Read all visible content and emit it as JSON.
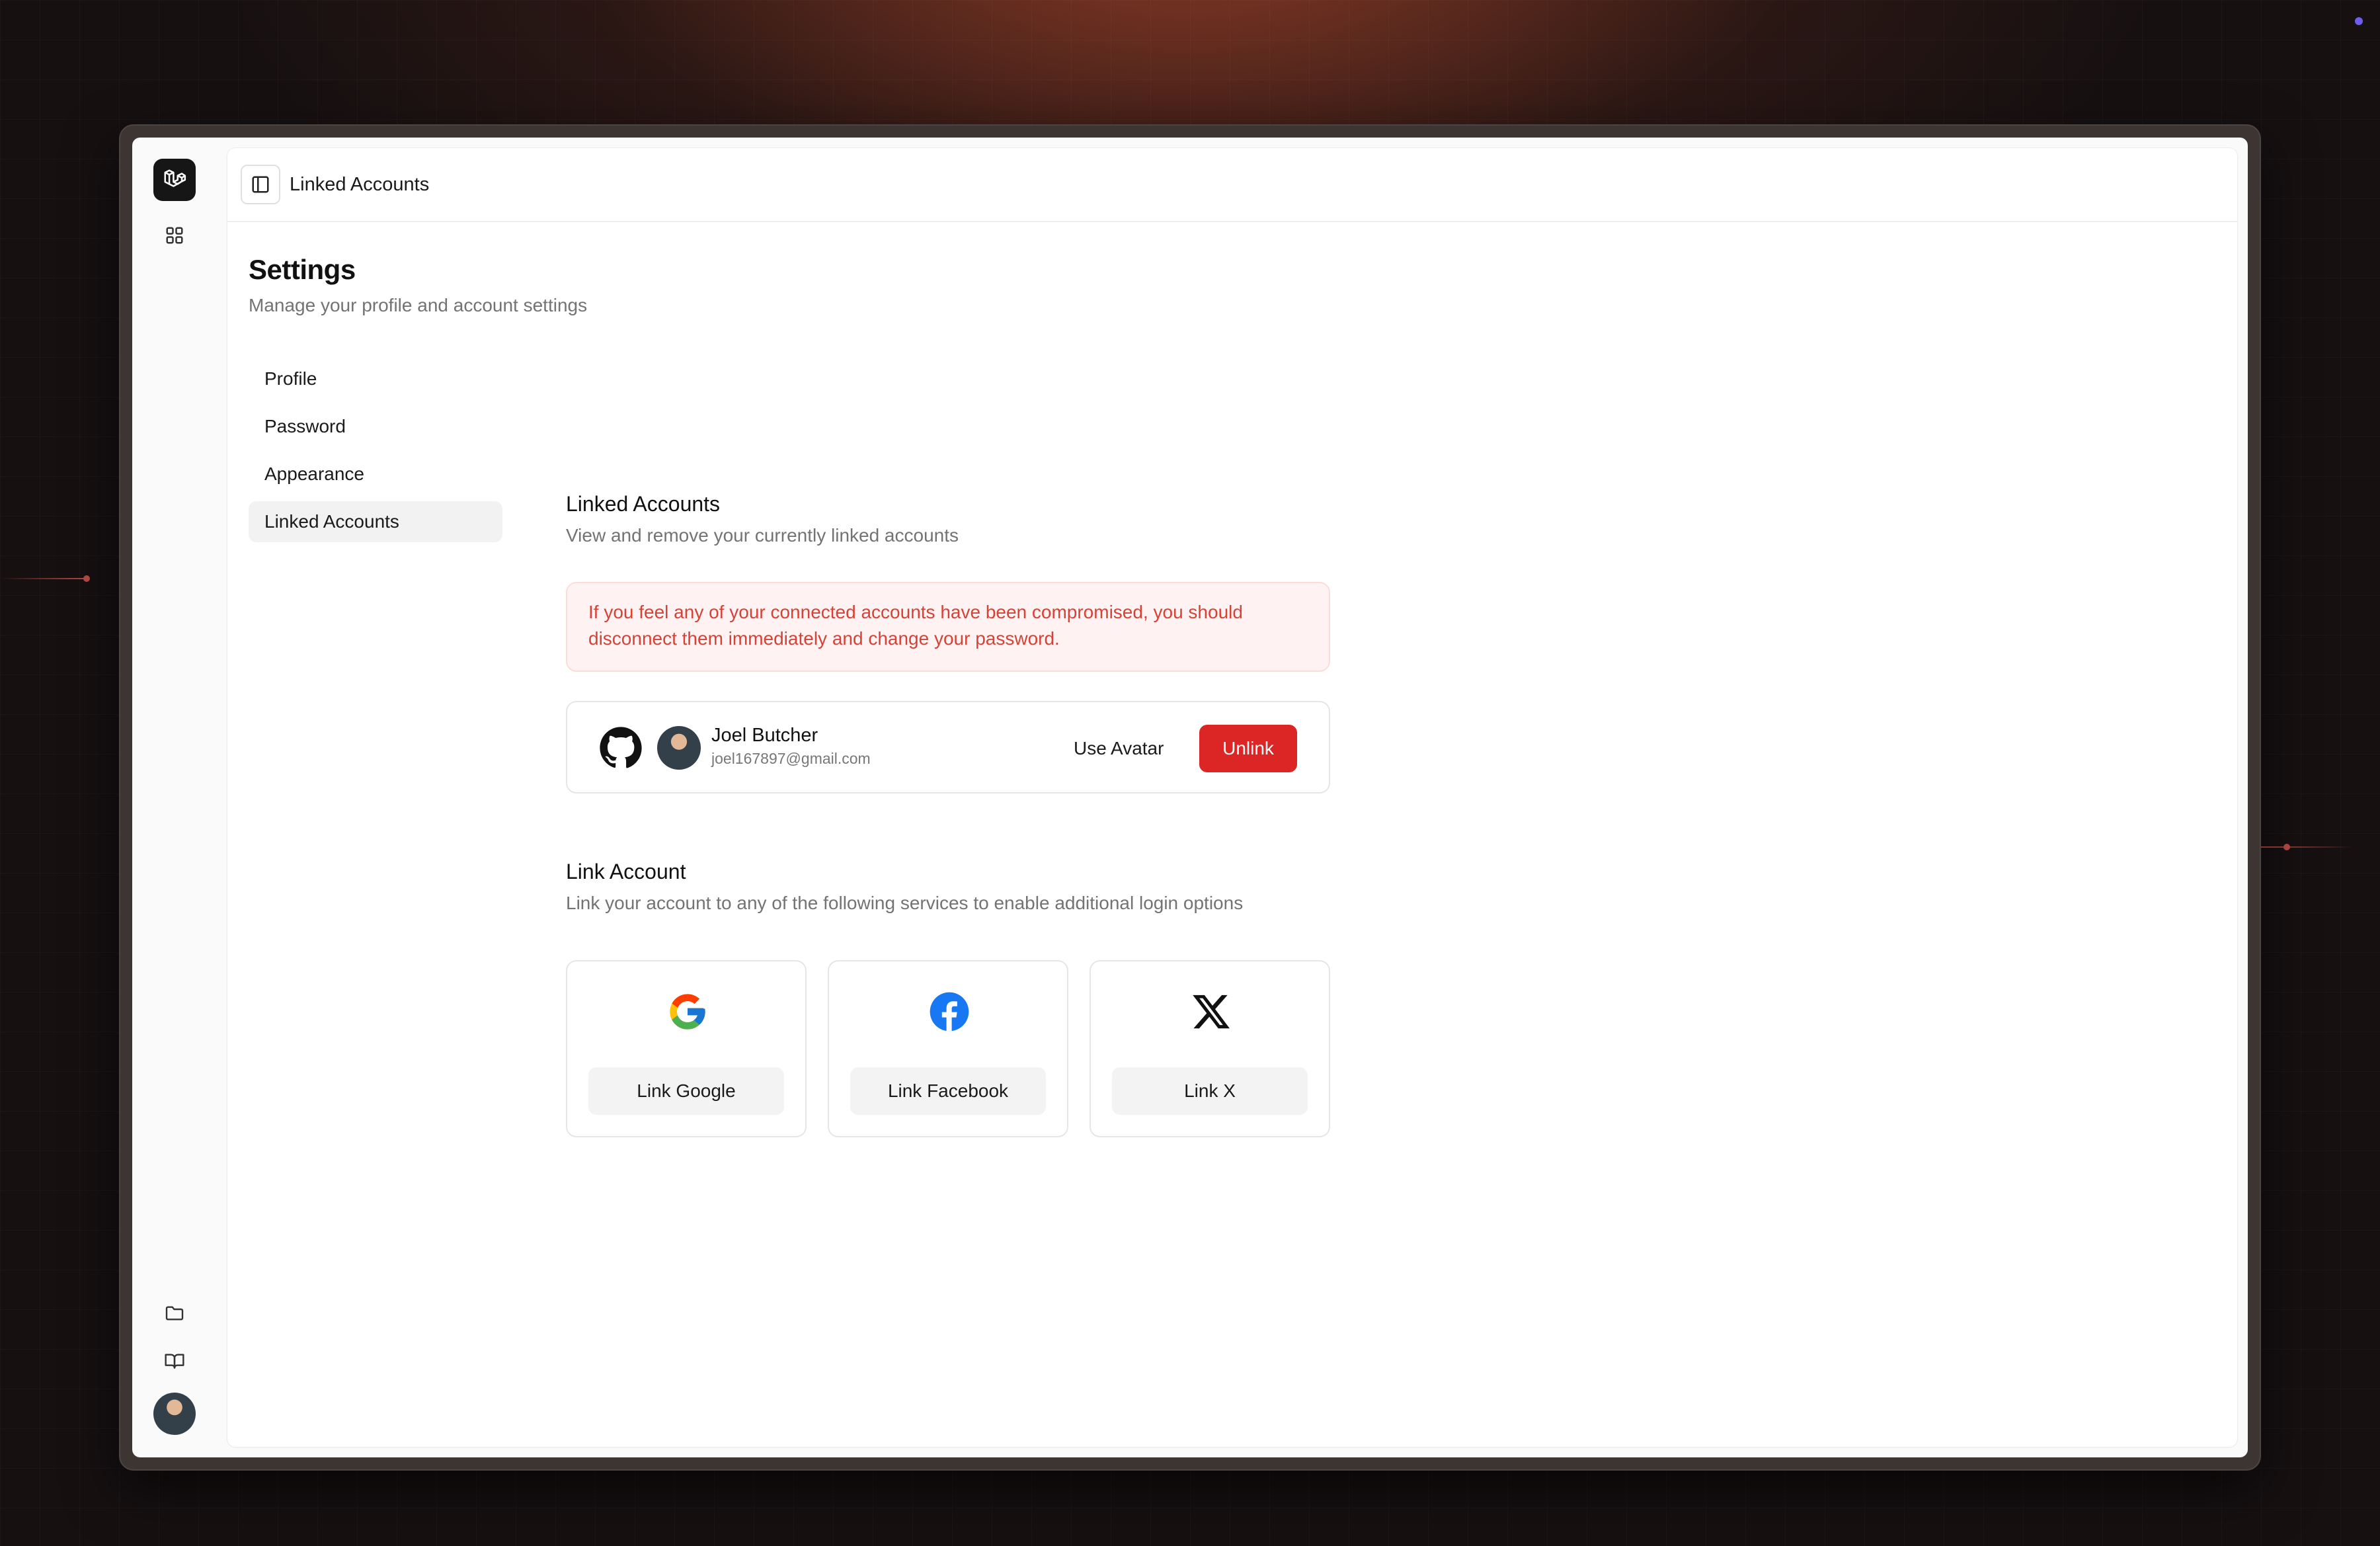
{
  "topbar": {
    "title": "Linked Accounts"
  },
  "settings": {
    "title": "Settings",
    "subtitle": "Manage your profile and account settings",
    "nav": [
      {
        "label": "Profile"
      },
      {
        "label": "Password"
      },
      {
        "label": "Appearance"
      },
      {
        "label": "Linked Accounts",
        "active": true
      }
    ]
  },
  "linked": {
    "title": "Linked Accounts",
    "subtitle": "View and remove your currently linked accounts",
    "alert": "If you feel any of your connected accounts have been compromised, you should disconnect them immediately and change your password.",
    "account": {
      "provider_icon": "github-icon",
      "name": "Joel Butcher",
      "email": "joel167897@gmail.com",
      "use_avatar_label": "Use Avatar",
      "unlink_label": "Unlink"
    }
  },
  "link": {
    "title": "Link Account",
    "subtitle": "Link your account to any of the following services to enable additional login options",
    "services": [
      {
        "icon": "google-icon",
        "label": "Link Google"
      },
      {
        "icon": "facebook-icon",
        "label": "Link Facebook"
      },
      {
        "icon": "x-icon",
        "label": "Link X"
      }
    ]
  },
  "colors": {
    "danger": "#dc2626",
    "alert_text": "#d64235",
    "alert_bg": "#fef3f2",
    "facebook": "#1877f2"
  }
}
